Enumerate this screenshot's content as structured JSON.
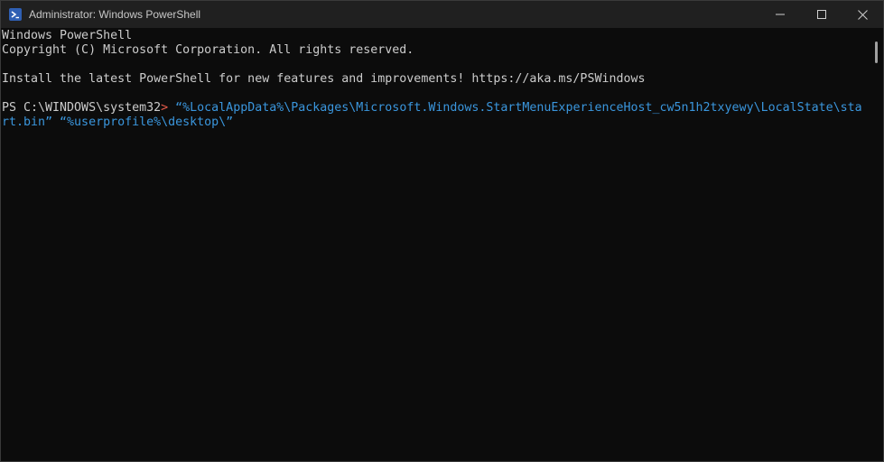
{
  "window": {
    "title": "Administrator: Windows PowerShell",
    "icon": "powershell-icon"
  },
  "caption_buttons": {
    "minimize_icon": "minimize-icon",
    "maximize_icon": "maximize-icon",
    "close_icon": "close-icon"
  },
  "console": {
    "line1": "Windows PowerShell",
    "line2": "Copyright (C) Microsoft Corporation. All rights reserved.",
    "line3": "Install the latest PowerShell for new features and improvements! https://aka.ms/PSWindows",
    "prompt": "PS C:\\WINDOWS\\system32",
    "prompt_symbol": ">",
    "command": " “%LocalAppData%\\Packages\\Microsoft.Windows.StartMenuExperienceHost_cw5n1h2txyewy\\LocalState\\start.bin” “%userprofile%\\desktop\\”"
  },
  "colors": {
    "background": "#0c0c0c",
    "titlebar": "#202020",
    "text": "#cccccc",
    "prompt_symbol": "#ea5c4b",
    "command": "#3a96dd"
  }
}
